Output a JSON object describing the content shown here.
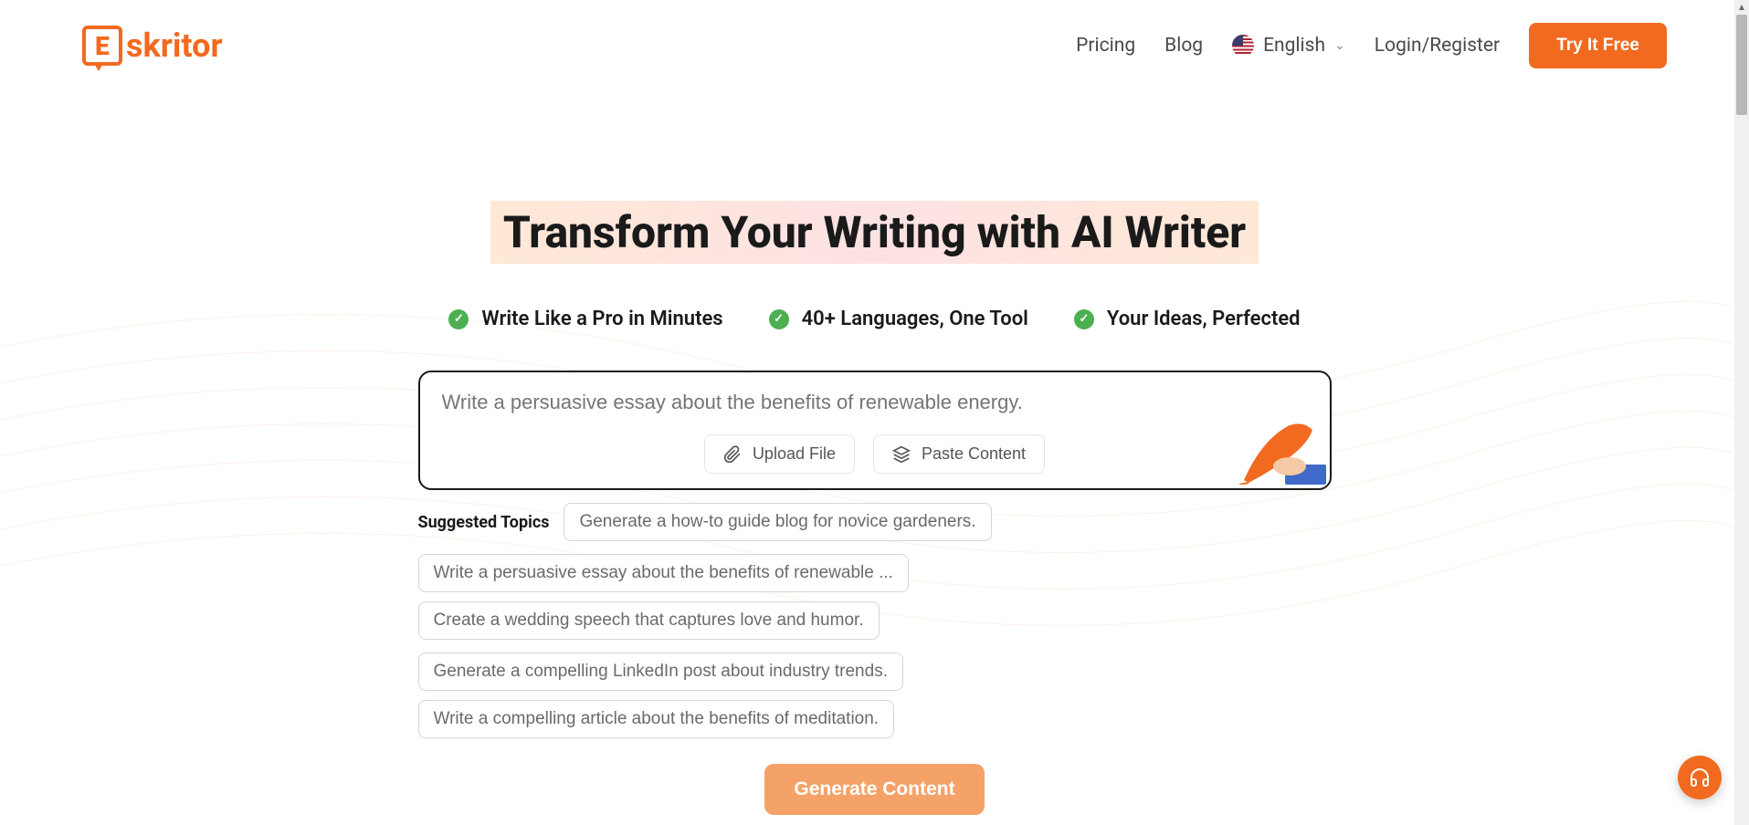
{
  "header": {
    "logo_text": "skritor",
    "logo_e": "E",
    "nav": {
      "pricing": "Pricing",
      "blog": "Blog",
      "language": "English",
      "login": "Login/Register"
    },
    "cta": "Try It Free"
  },
  "hero": {
    "title": "Transform Your Writing with AI Writer",
    "features": [
      "Write Like a Pro in Minutes",
      "40+ Languages, One Tool",
      "Your Ideas, Perfected"
    ]
  },
  "input": {
    "placeholder": "Write a persuasive essay about the benefits of renewable energy.",
    "upload": "Upload File",
    "paste": "Paste Content"
  },
  "suggested": {
    "label": "Suggested Topics",
    "topics": [
      "Generate a how-to guide blog for novice gardeners.",
      "Write a persuasive essay about the benefits of renewable ...",
      "Create a wedding speech that captures love and humor.",
      "Generate a compelling LinkedIn post about industry trends.",
      "Write a compelling article about the benefits of meditation."
    ]
  },
  "generate": "Generate Content"
}
